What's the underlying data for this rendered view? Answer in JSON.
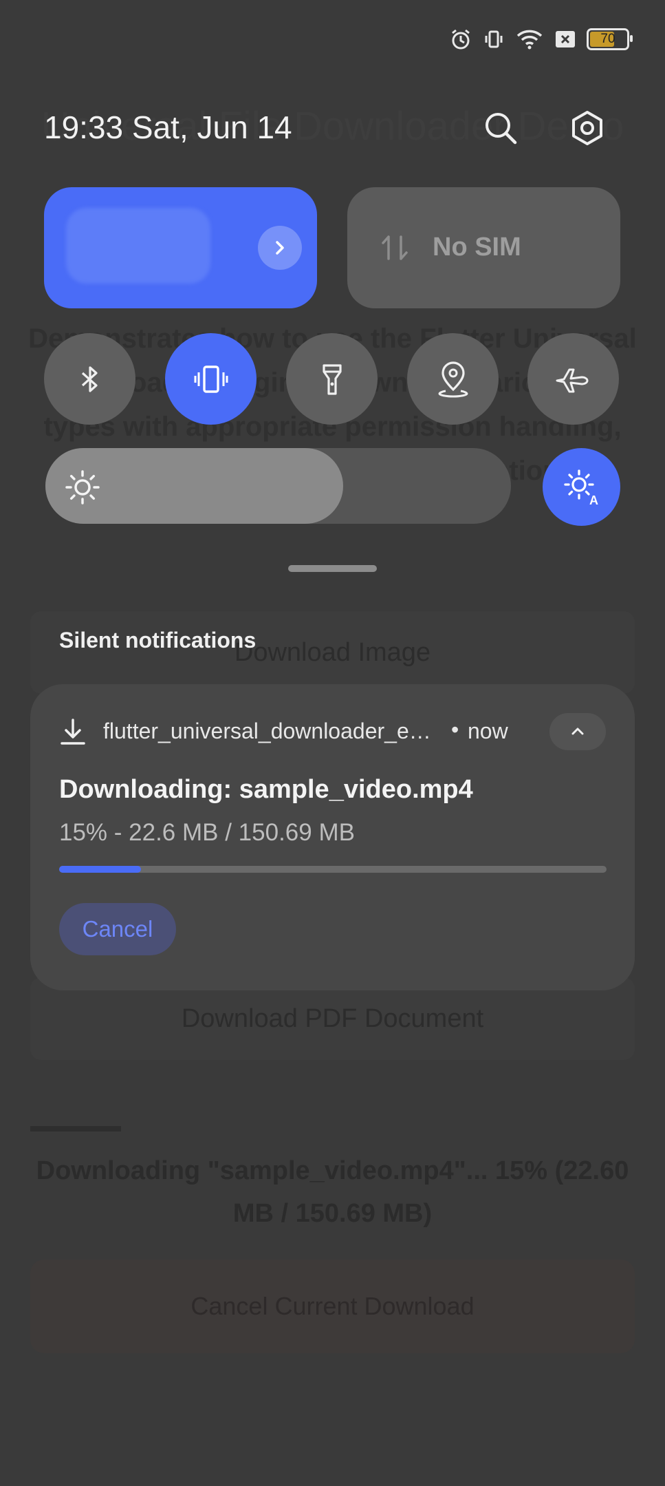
{
  "background_app": {
    "title": "Universal File Downloader Demo",
    "description": "Demonstrates how to use the Flutter Universal Downloader plugin to download various file types with appropriate permission handling, progress updates, and cancellation.",
    "buttons": [
      "Download Image",
      "Download PDF Document"
    ],
    "status": "Downloading \"sample_video.mp4\"... 15% (22.60 MB / 150.69 MB)",
    "cancel_button": "Cancel Current Download"
  },
  "status_bar": {
    "icons": [
      "alarm-icon",
      "vibrate-icon",
      "wifi-icon",
      "no-sim-icon",
      "battery-icon"
    ],
    "battery_level": "70",
    "battery_fraction": 0.7,
    "battery_color": "#c79a2a"
  },
  "header": {
    "datetime": "19:33  Sat, Jun 14",
    "search_icon": "search-icon",
    "settings_icon": "settings-icon"
  },
  "tiles": {
    "network": {
      "icon": "chevron-right-icon",
      "color": "#4a6cf7"
    },
    "sim": {
      "label": "No SIM",
      "icon": "data-arrows-icon"
    }
  },
  "toggles": [
    {
      "name": "bluetooth",
      "icon": "bluetooth-icon",
      "on": false
    },
    {
      "name": "vibrate",
      "icon": "vibrate-icon",
      "on": true
    },
    {
      "name": "flashlight",
      "icon": "flashlight-icon",
      "on": false
    },
    {
      "name": "location",
      "icon": "location-icon",
      "on": false
    },
    {
      "name": "airplane",
      "icon": "airplane-icon",
      "on": false
    }
  ],
  "brightness": {
    "level": 0.64,
    "auto": true
  },
  "notifications": {
    "section_title": "Silent notifications",
    "items": [
      {
        "app_name": "flutter_universal_downloader_e…",
        "separator": "•",
        "time": "now",
        "title": "Downloading: sample_video.mp4",
        "subtitle": "15% - 22.6 MB / 150.69 MB",
        "progress": 0.15,
        "action_label": "Cancel"
      }
    ]
  },
  "colors": {
    "accent": "#4a6cf7",
    "shade_bg": "#3a3a3a",
    "card_bg": "#474747"
  }
}
